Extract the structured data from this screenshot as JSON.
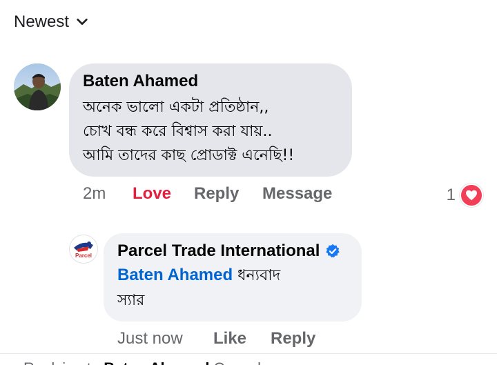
{
  "sort": {
    "label": "Newest",
    "icon": "chevron-down-icon"
  },
  "comment": {
    "author": "Baten Ahamed",
    "lines": [
      "অনেক ভালো একটা প্রতিষ্ঠান,,",
      "চোখ বন্ধ করে বিশ্বাস করা যায়..",
      "আমি তাদের কাছ প্রোডাক্ট এনেছি!!"
    ],
    "time": "2m",
    "reaction_action": "Love",
    "reply_label": "Reply",
    "message_label": "Message",
    "reaction_count": "1",
    "reaction_icon": "love-heart-icon",
    "reaction_color": "#f33e58"
  },
  "reply": {
    "author": "Parcel Trade International",
    "verified_icon": "verified-badge-icon",
    "mention": "Baten Ahamed",
    "text_inline": "ধন্যবাদ",
    "text_line2": "স্যার",
    "time": "Just now",
    "like_label": "Like",
    "reply_label": "Reply",
    "logo_text": "Parcel"
  },
  "footer": {
    "replying_prefix": "Replying to",
    "replying_name": "Baten Ahamed",
    "cancel_label": "Cancel"
  },
  "colors": {
    "love": "#e41e3f",
    "link": "#0064d1",
    "verified": "#1877f2",
    "muted": "#65676b"
  }
}
